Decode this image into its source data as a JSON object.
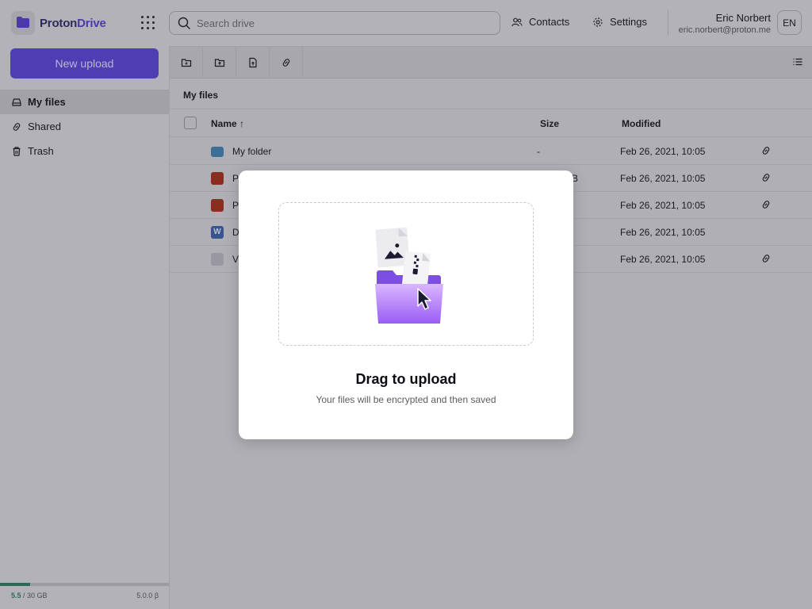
{
  "app": {
    "brand_first": "Proton",
    "brand_second": "Drive"
  },
  "topbar": {
    "search_placeholder": "Search drive",
    "contacts_label": "Contacts",
    "settings_label": "Settings",
    "user_name": "Eric Norbert",
    "user_email": "eric.norbert@proton.me",
    "avatar_initials": "EN"
  },
  "sidebar": {
    "new_upload_label": "New upload",
    "items": [
      {
        "label": "My files",
        "icon": "hard-drive-icon",
        "active": true
      },
      {
        "label": "Shared",
        "icon": "link-icon",
        "active": false
      },
      {
        "label": "Trash",
        "icon": "trash-icon",
        "active": false
      }
    ],
    "storage": {
      "used": "5.5",
      "total": " / 30 GB",
      "used_fraction": 0.18,
      "version": "5.0.0 β"
    }
  },
  "main": {
    "toolbar_icons": [
      "new-folder-icon",
      "upload-folder-icon",
      "upload-file-icon",
      "share-link-icon"
    ],
    "view_icon": "list-view-icon",
    "breadcrumb": "My files",
    "columns": {
      "name": "Name",
      "sort_indicator": "↑",
      "size": "Size",
      "modified": "Modified"
    },
    "rows": [
      {
        "type": "folder",
        "name": "My folder",
        "size": "-",
        "modified": "Feb 26, 2021, 10:05",
        "shared": true
      },
      {
        "type": "pdf",
        "name": "P",
        "size": "B",
        "modified": "Feb 26, 2021, 10:05",
        "shared": true
      },
      {
        "type": "pdf",
        "name": "P",
        "size": "",
        "modified": "Feb 26, 2021, 10:05",
        "shared": true
      },
      {
        "type": "doc",
        "name": "D",
        "size": "",
        "modified": "Feb 26, 2021, 10:05",
        "shared": false
      },
      {
        "type": "zip",
        "name": "V",
        "size": "",
        "modified": "Feb 26, 2021, 10:05",
        "shared": true
      }
    ]
  },
  "modal": {
    "title": "Drag to upload",
    "subtitle": "Your files will be encrypted and then saved"
  },
  "colors": {
    "brand": "#6d4aff",
    "overlay": "#b2b1b7",
    "storage": "#2b6b56"
  }
}
